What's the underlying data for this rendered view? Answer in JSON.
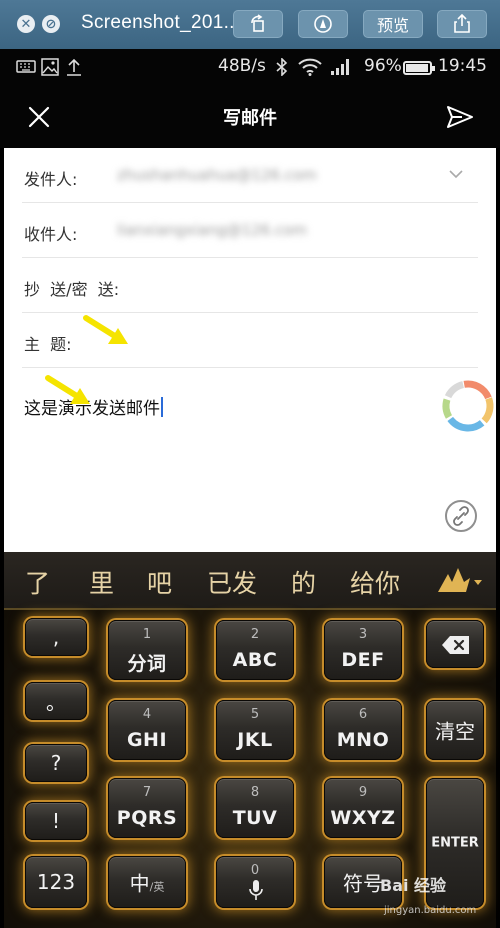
{
  "titlebar": {
    "filename": "Screenshot_201...",
    "preview_label": "预览"
  },
  "statusbar": {
    "speed": "48B/s",
    "battery": "96%",
    "time": "19:45"
  },
  "header": {
    "title": "写邮件"
  },
  "form": {
    "from_label": "发件人:",
    "from_value": "zhushanhuahua@126.com",
    "to_label": "收件人:",
    "to_value": "lianxiangxiang@126.com",
    "cc_label": "抄  送/密  送:",
    "subject_label": "主  题:",
    "body": "这是演示发送邮件"
  },
  "keyboard": {
    "candidates": [
      "了",
      "里",
      "吧",
      "已发",
      "的",
      "给你"
    ],
    "left_column": [
      ",",
      "。",
      "?",
      "!",
      "123"
    ],
    "keys": [
      {
        "num": "1",
        "main": "分词"
      },
      {
        "num": "2",
        "main": "ABC"
      },
      {
        "num": "3",
        "main": "DEF"
      },
      {
        "num": "4",
        "main": "GHI"
      },
      {
        "num": "5",
        "main": "JKL"
      },
      {
        "num": "6",
        "main": "MNO"
      },
      {
        "num": "7",
        "main": "PQRS"
      },
      {
        "num": "8",
        "main": "TUV"
      },
      {
        "num": "9",
        "main": "WXYZ"
      }
    ],
    "zhong": "中",
    "ying": "/英",
    "zero": "0",
    "symbol": "符号",
    "clear": "清空",
    "enter": "ENTER"
  },
  "watermark": {
    "text": "Bai 经验",
    "url": "jingyan.baidu.com"
  }
}
